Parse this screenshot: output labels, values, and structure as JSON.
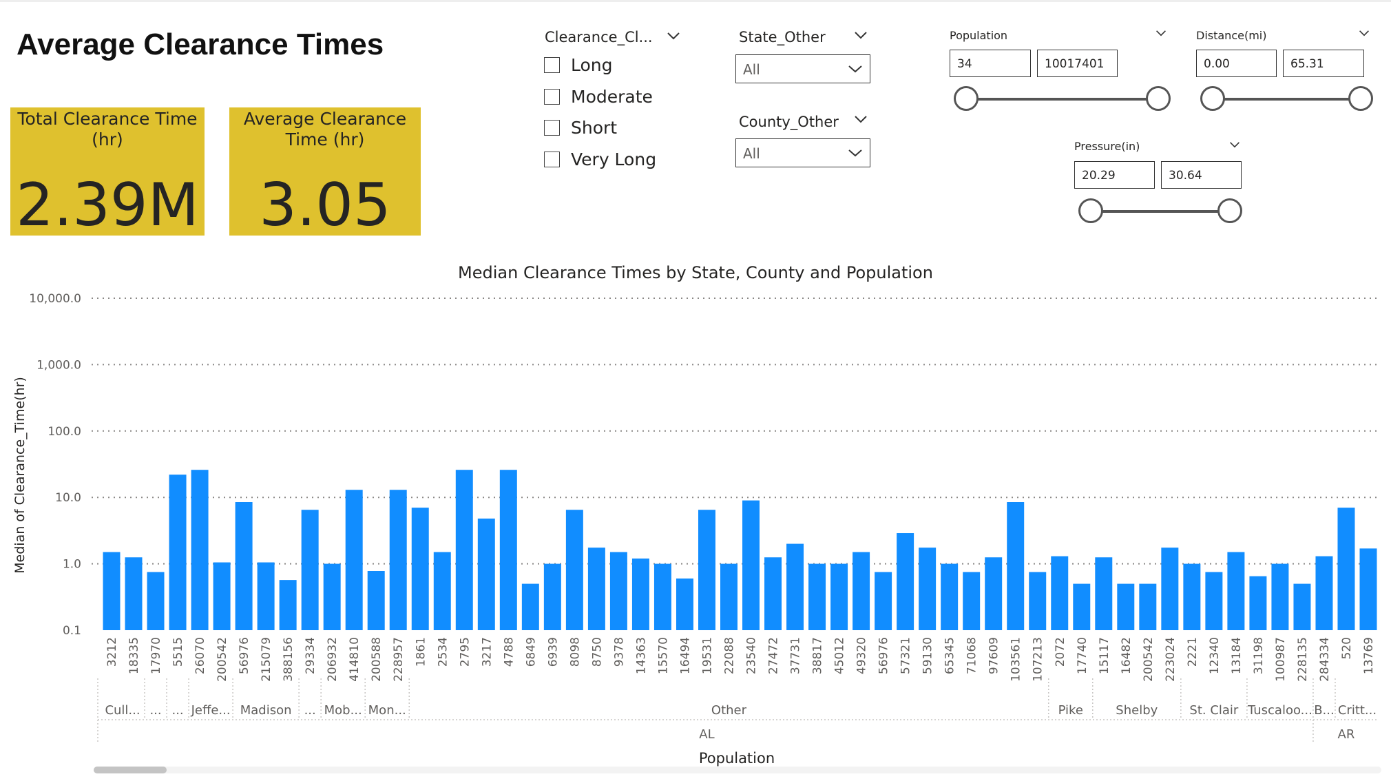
{
  "page": {
    "title": "Average Clearance Times"
  },
  "cards": [
    {
      "label": "Total Clearance Time (hr)",
      "value": "2.39M"
    },
    {
      "label": "Average Clearance Time (hr)",
      "value": "3.05"
    }
  ],
  "slicers": {
    "clearance_class": {
      "title": "Clearance_Cl...",
      "options": [
        "Long",
        "Moderate",
        "Short",
        "Very Long"
      ]
    },
    "state": {
      "title": "State_Other",
      "value": "All"
    },
    "county": {
      "title": "County_Other",
      "value": "All"
    },
    "population": {
      "title": "Population",
      "min": "34",
      "max": "10017401"
    },
    "distance": {
      "title": "Distance(mi)",
      "min": "0.00",
      "max": "65.31"
    },
    "pressure": {
      "title": "Pressure(in)",
      "min": "20.29",
      "max": "30.64"
    }
  },
  "colors": {
    "bar": "#118dff",
    "card": "#dfc12e"
  },
  "chart_data": {
    "type": "bar",
    "title": "Median Clearance Times by State, County and Population",
    "xlabel": "Population",
    "ylabel": "Median of Clearance_Time(hr)",
    "yscale": "log",
    "ylim": [
      0.1,
      10000
    ],
    "yticks": [
      "10,000.0",
      "1,000.0",
      "100.0",
      "10.0",
      "1.0",
      "0.1"
    ],
    "grid": true,
    "categories": [
      "3212",
      "18335",
      "17970",
      "5515",
      "26070",
      "200542",
      "56976",
      "215079",
      "388156",
      "29334",
      "206932",
      "414810",
      "200588",
      "228957",
      "1861",
      "2534",
      "2795",
      "3217",
      "4788",
      "6849",
      "6939",
      "8098",
      "8750",
      "9378",
      "14363",
      "15570",
      "16494",
      "19531",
      "22088",
      "23540",
      "27472",
      "37731",
      "38817",
      "45012",
      "49320",
      "56976",
      "57321",
      "59130",
      "65345",
      "71068",
      "97609",
      "103561",
      "107213",
      "2072",
      "17740",
      "15117",
      "16482",
      "200542",
      "223024",
      "2221",
      "12340",
      "13184",
      "31198",
      "100987",
      "228135",
      "284334",
      "520",
      "13769"
    ],
    "values": [
      1.5,
      1.25,
      0.75,
      22,
      26,
      1.05,
      8.5,
      1.05,
      0.57,
      6.5,
      1.0,
      13,
      0.78,
      13,
      7,
      1.5,
      26,
      4.8,
      26,
      0.5,
      1.0,
      6.5,
      1.75,
      1.5,
      1.2,
      1.0,
      0.6,
      6.5,
      1.0,
      9,
      1.25,
      2.0,
      1.0,
      1.0,
      1.5,
      0.75,
      2.9,
      1.75,
      1.0,
      0.75,
      1.25,
      8.5,
      0.75,
      1.3,
      0.5,
      1.25,
      0.5,
      0.5,
      1.75,
      1.0,
      0.75,
      1.5,
      0.65,
      1.0,
      0.5,
      1.3,
      7,
      1.7
    ],
    "county_groups": [
      {
        "label": "Cull...",
        "count": 2
      },
      {
        "label": "...",
        "count": 1
      },
      {
        "label": "...",
        "count": 1
      },
      {
        "label": "Jeffe...",
        "count": 2
      },
      {
        "label": "Madison",
        "count": 3
      },
      {
        "label": "...",
        "count": 1
      },
      {
        "label": "Mob...",
        "count": 2
      },
      {
        "label": "Mon...",
        "count": 2
      },
      {
        "label": "Other",
        "count": 29
      },
      {
        "label": "Pike",
        "count": 2
      },
      {
        "label": "Shelby",
        "count": 4
      },
      {
        "label": "St. Clair",
        "count": 3
      },
      {
        "label": "Tuscaloo...",
        "count": 3
      },
      {
        "label": "B...",
        "count": 1
      },
      {
        "label": "Critt...",
        "count": 2
      }
    ],
    "state_groups": [
      {
        "label": "AL",
        "count": 55
      },
      {
        "label": "AR",
        "count": 3
      }
    ]
  }
}
